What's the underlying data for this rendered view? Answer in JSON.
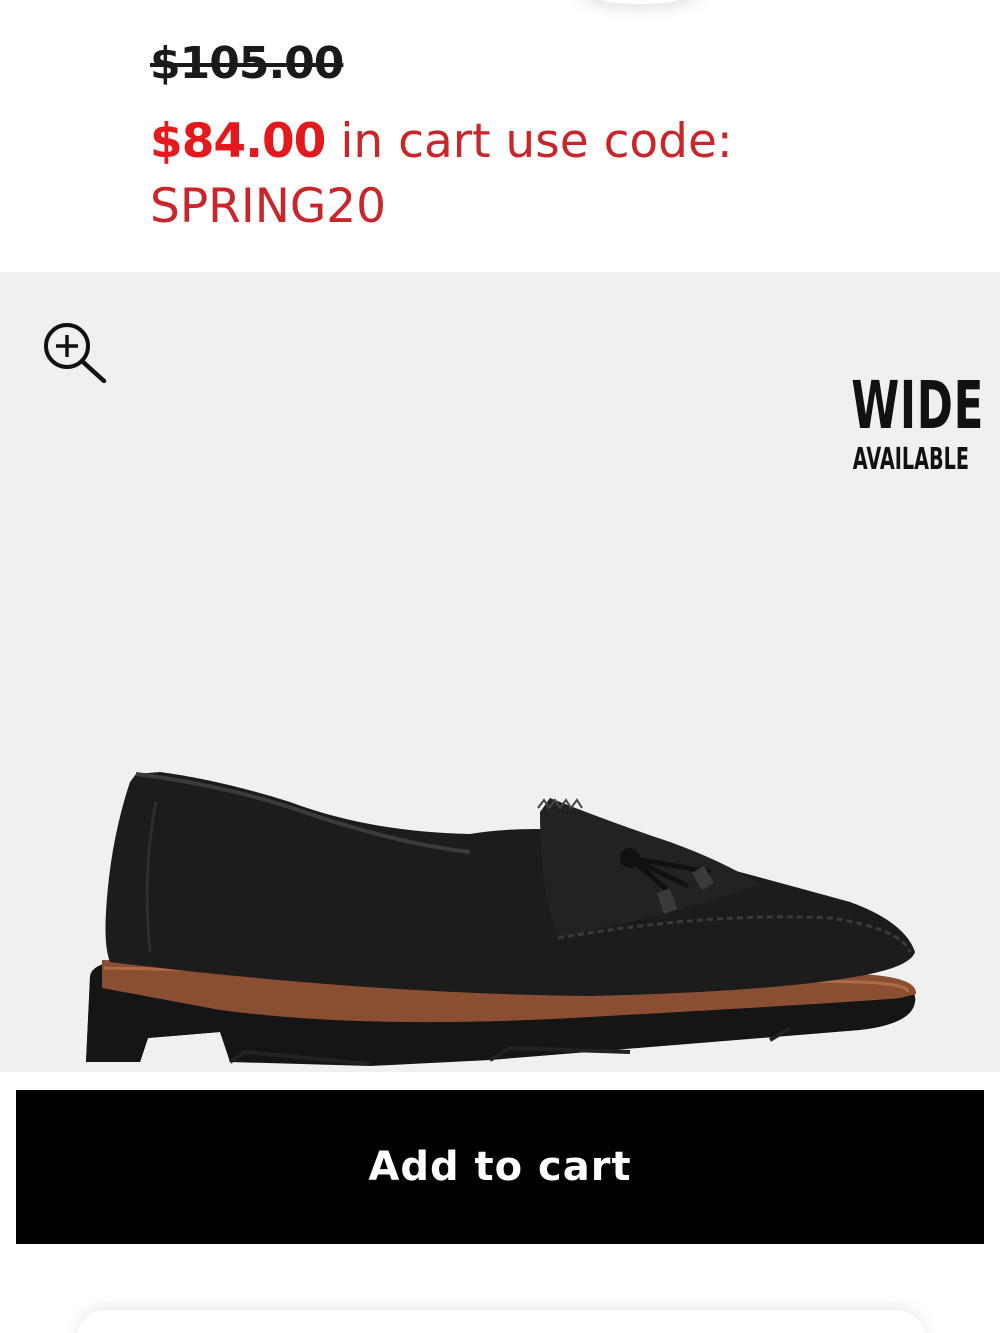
{
  "pricing": {
    "original_price": "$105.00",
    "sale_price": "$84.00",
    "promo_text": " in cart use code:",
    "promo_code": "SPRING20",
    "colors": {
      "sale_red": "#e3191d",
      "promo_red": "#c8262b",
      "strikethrough_text": "#1a1a1a"
    }
  },
  "product_image": {
    "zoom_icon": "zoom-in-icon",
    "badge": {
      "line1": "WIDE",
      "line2": "AVAILABLE"
    },
    "background": "#f0f0f0"
  },
  "actions": {
    "add_to_cart_label": "Add to cart",
    "button_color": "#000000"
  }
}
